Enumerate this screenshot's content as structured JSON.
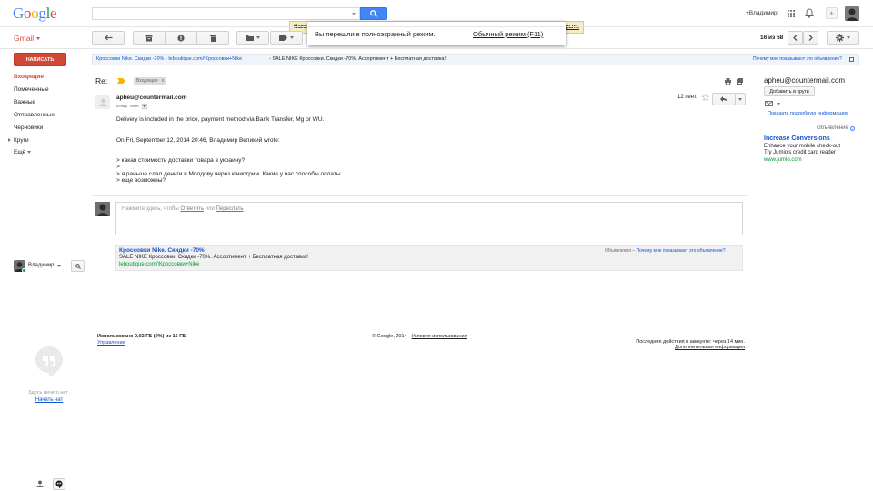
{
  "header": {
    "logo": "Google",
    "search": {
      "value": "",
      "placeholder": ""
    },
    "user_name": "+Владимир"
  },
  "fullscreen_notice": {
    "text": "Вы перешли в полноэкранный режим.",
    "exit_label": "Обычный режим (F11)",
    "behind_left": "Нажм",
    "behind_right": "рыть"
  },
  "toolbar": {
    "gmail_label": "Gmail",
    "pagination": "16 из 58"
  },
  "sidebar": {
    "compose_label": "НАПИСАТЬ",
    "items": [
      {
        "label": "Входящие"
      },
      {
        "label": "Помеченные"
      },
      {
        "label": "Важные"
      },
      {
        "label": "Отправленные"
      },
      {
        "label": "Черновики"
      },
      {
        "label": "Круги"
      },
      {
        "label": "Ещё"
      }
    ],
    "chat_user": "Владимир",
    "chat_empty": "Здесь ничего нет",
    "start_chat": "Начать чат"
  },
  "top_ad": {
    "link": "Кроссовки Nike. Скидки -70% - leboutique.com/!Кроссовки+Nike",
    "text": "- SALE NIKE Кроссовки. Скидки -70%. Ассортимент + Бесплатная доставка!",
    "why": "Почему мне показывают это объявление?"
  },
  "thread": {
    "subject": "Re:",
    "label_tag": "Входящие",
    "label_close": "x"
  },
  "message": {
    "sender": "apheu@countermail.com",
    "recipient": "кому: мне",
    "date": "12 сент.",
    "body": [
      "Delivery is included in the price, payment method via Bank Transfer, Mg or WU.",
      "On Fri, September 12, 2014 20:46, Владимир Великий wrote:",
      "> какая стоимость доставки товара в украину?",
      ">",
      "> я раньше слал деньги в Молдову через юнистрим. Какие у вас способы оплаты",
      "> еще возможны?"
    ]
  },
  "reply": {
    "prompt": "Нажмите здесь, чтобы",
    "reply_link": "Ответить",
    "or": "или",
    "forward_link": "Переслать"
  },
  "bottom_ad": {
    "title": "Кроссовки Nike. Скидки -70%",
    "text": "SALE NIKE Кроссовки. Скидки -70%. Ассортимент + Бесплатная доставка!",
    "url": "leboutique.com/!Кроссовки+Nike",
    "ads_label": "Объявления –",
    "why": "Почему мне показывают это объявление?"
  },
  "footer": {
    "storage": "Использовано 0,02 ГБ (0%) из 15 ГБ",
    "manage": "Управление",
    "copyright": "© Google, 2014 -",
    "terms": "Условия использования",
    "last_activity": "Последние действия в аккаунте: через 14 мин.",
    "details": "Дополнительная информация"
  },
  "right_panel": {
    "email": "apheu@countermail.com",
    "add_to_circles": "Добавить в круги",
    "show_details": "Показать подробную информацию",
    "ad_label": "Объявление",
    "ad_title": "Increase Conversions",
    "ad_line1": "Enhance your mobile check-out",
    "ad_line2": "Try Jumio's credit card reader",
    "ad_url": "www.jumio.com"
  },
  "colors": {
    "accent_red": "#dd4b39",
    "search_blue": "#4285f4",
    "link_blue": "#15c",
    "green_url": "#093"
  }
}
